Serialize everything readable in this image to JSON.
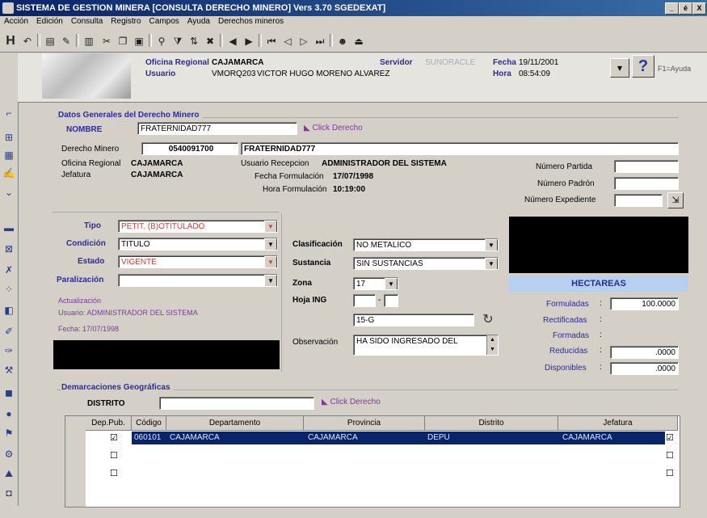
{
  "window": {
    "title": "SISTEMA DE GESTION MINERA  [CONSULTA DERECHO MINERO]  Vers  3.70 SGEDEXAT]"
  },
  "window_buttons": [
    "_",
    "é",
    "X"
  ],
  "menu": [
    "Acción",
    "Edición",
    "Consulta",
    "Registro",
    "Campos",
    "Ayuda",
    "Derechos mineros"
  ],
  "header": {
    "oficina_label": "Oficina Regional",
    "oficina_value": "CAJAMARCA",
    "usuario_label": "Usuario",
    "usuario_code": "VMORQ203",
    "usuario_name": "VICTOR HUGO MORENO ALVAREZ",
    "servidor_label": "Servidor",
    "servidor_value": "SUNORACLE",
    "fecha_label": "Fecha",
    "fecha_value": "19/11/2001",
    "hora_label": "Hora",
    "hora_value": "08:54:09",
    "help_glyph": "?",
    "f1_label": "F1=Ayuda"
  },
  "datos": {
    "section_title": "Datos Generales del Derecho Minero",
    "nombre_label": "NOMBRE",
    "nombre_value": "FRATERNIDAD777",
    "click_hint": "Click Derecho",
    "derecho_label": "Derecho Minero",
    "derecho_code": "0540091700",
    "derecho_name": "FRATERNIDAD777",
    "oficina_label": "Oficina Regional",
    "oficina_value": "CAJAMARCA",
    "jefatura_label": "Jefatura",
    "jefatura_value": "CAJAMARCA",
    "usuario_recepcion_label": "Usuario Recepcion",
    "usuario_recepcion_value": "ADMINISTRADOR DEL SISTEMA",
    "fecha_formulacion_label": "Fecha Formulación",
    "fecha_formulacion_value": "17/07/1998",
    "hora_formulacion_label": "Hora Formulación",
    "hora_formulacion_value": "10:19:00",
    "numero_partida_label": "Número Partida",
    "numero_padron_label": "Número Padrón",
    "numero_expediente_label": "Número Expediente"
  },
  "left_form": {
    "tipo_label": "Tipo",
    "tipo_value": "PETIT. (B)OTITULADO",
    "condicion_label": "Condición",
    "condicion_value": "TITULO",
    "estado_label": "Estado",
    "estado_value": "VIGENTE",
    "paralizacion_label": "Paralización",
    "actualizacion_label": "Actualización",
    "actualizacion_usuario": "Usuario: ADMINISTRADOR DEL SISTEMA",
    "actualizacion_fecha": "Fecha: 17/07/1998"
  },
  "mid_form": {
    "clasificacion_label": "Clasificación",
    "clasificacion_value": "NO METALICO",
    "sustancia_label": "Sustancia",
    "sustancia_value": "SIN SUSTANCIAS",
    "zona_label": "Zona",
    "zona_value": "17",
    "hoja_label": "Hoja ING",
    "hoja_value": "15-G",
    "observacion_label": "Observación",
    "observacion_value": "HA SIDO INGRESADO DEL"
  },
  "hectareas": {
    "title": "HECTAREAS",
    "formuladas_label": "Formuladas",
    "formuladas_value": "100.0000",
    "rectificadas_label": "Rectificadas",
    "formadas_label": "Formadas",
    "reducidas_label": "Reducidas",
    "reducidas_value": ".0000",
    "disponibles_label": "Disponibles",
    "disponibles_value": ".0000"
  },
  "demarcaciones": {
    "section_title": "Demarcaciones Geográficas",
    "distrito_label": "DISTRITO",
    "click_hint": "Click Derecho",
    "columns": [
      "Dep.Pub.",
      "Código",
      "Departamento",
      "Provincia",
      "Distrito",
      "Jefatura"
    ],
    "row": {
      "codigo": "060101",
      "departamento": "CAJAMARCA",
      "provincia": "CAJAMARCA",
      "distrito": "DEPU",
      "jefatura": "CAJAMARCA"
    }
  }
}
